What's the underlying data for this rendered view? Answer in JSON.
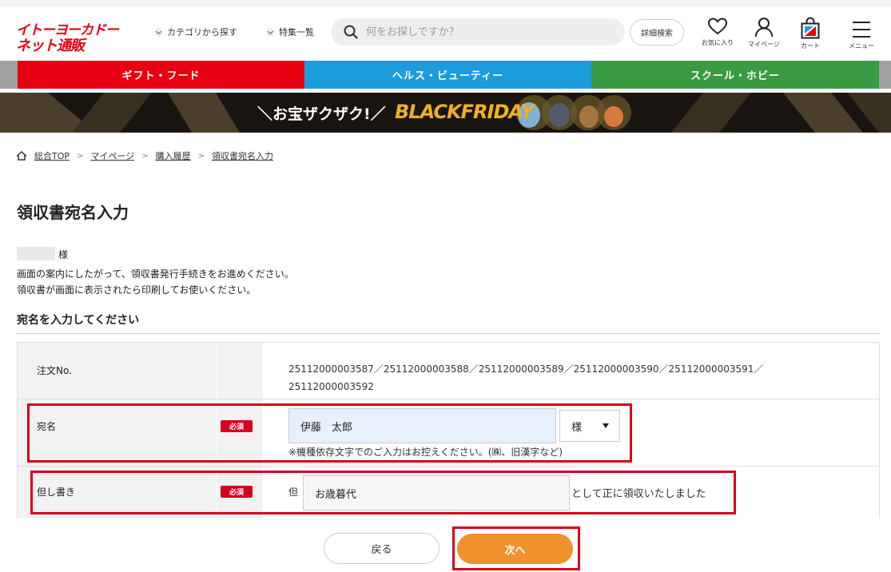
{
  "header": {
    "logo_line1": "イトーヨーカドー",
    "logo_line2": "ネット通販",
    "nav": [
      "カテゴリから探す",
      "特集一覧"
    ],
    "search_placeholder": "何をお探しですか？",
    "advanced_search": "詳細検索",
    "icons": [
      {
        "icon": "heart-icon",
        "label": "お気に入り"
      },
      {
        "icon": "user-icon",
        "label": "マイページ"
      },
      {
        "icon": "cart-icon",
        "label": "カート"
      },
      {
        "icon": "menu-icon",
        "label": "メニュー"
      }
    ]
  },
  "categories": [
    {
      "label": "ギフト・フード",
      "color": "#e60012"
    },
    {
      "label": "ヘルス・ビューティー",
      "color": "#1b9ddb"
    },
    {
      "label": "スクール・ホビー",
      "color": "#3a9a41"
    }
  ],
  "banner": {
    "text": "＼お宝ザクザク!／",
    "brand": "BLACKFRIDAY"
  },
  "breadcrumb": [
    "総合TOP",
    "マイページ",
    "購入履歴",
    "領収書宛名入力"
  ],
  "page_title": "領収書宛名入力",
  "customer_suffix": "様",
  "intro": [
    "画面の案内にしたがって、領収書発行手続きをお進めください。",
    "領収書が画面に表示されたら印刷してお使いください。"
  ],
  "section_title": "宛名を入力してください",
  "form": {
    "order_label": "注文No.",
    "order_numbers_line1": "25112000003587／25112000003588／25112000003589／25112000003590／25112000003591／",
    "order_numbers_line2": "25112000003592",
    "addressee_label": "宛名",
    "required_badge": "必須",
    "addressee_value": "伊藤　太郎",
    "honorific_value": "様",
    "addressee_note": "※機種依存文字でのご入力はお控えください。(㈱、旧漢字など)",
    "proviso_label": "但し書き",
    "proviso_prefix": "但",
    "proviso_value": "お歳暮代",
    "proviso_suffix": "として正に領収いたしました"
  },
  "buttons": {
    "back": "戻る",
    "next": "次へ"
  },
  "colors": {
    "highlight": "#d5001c",
    "next_button": "#f0922c"
  }
}
